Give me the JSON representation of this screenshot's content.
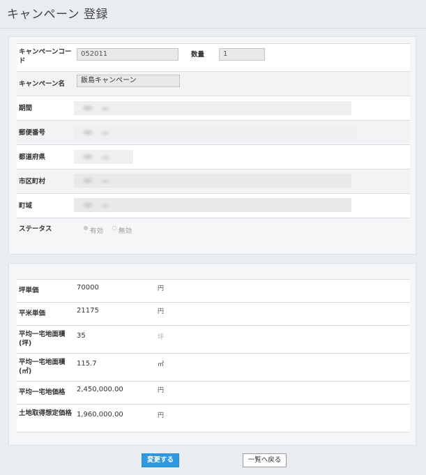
{
  "page": {
    "title": "キャンペーン 登録"
  },
  "campaign": {
    "code_label": "キャンペーンコード",
    "code_value": "052011",
    "quantity_label": "数量",
    "quantity_value": "1",
    "name_label": "キャンペーン名",
    "name_value": "飯島キャンペーン",
    "period_label": "期間",
    "postal_label": "郵便番号",
    "prefecture_label": "都道府県",
    "city_label": "市区町村",
    "town_label": "町域",
    "status_label": "ステータス",
    "status_options": [
      "有効",
      "無効"
    ]
  },
  "pricing": {
    "rows": [
      {
        "label": "坪単価",
        "value": "70000",
        "unit": "円"
      },
      {
        "label": "平米単価",
        "value": "21175",
        "unit": "円"
      },
      {
        "label": "平均一宅地面積(坪)",
        "value": "35",
        "unit": "坪"
      },
      {
        "label": "平均一宅地面積(㎡)",
        "value": "115.7",
        "unit": "㎡"
      },
      {
        "label": "平均一宅地価格",
        "value": "2,450,000.00",
        "unit": "円"
      },
      {
        "label": "土地取得想定価格",
        "value": "1,960,000.00",
        "unit": "円"
      }
    ]
  },
  "buttons": {
    "submit_label": "変更する",
    "back_label": "一覧へ戻る"
  }
}
